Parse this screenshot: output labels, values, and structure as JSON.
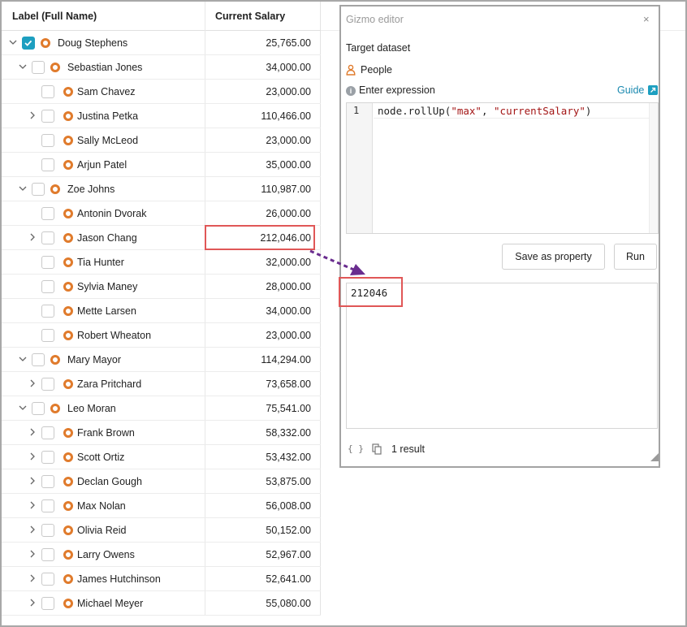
{
  "table": {
    "columns": [
      "Label (Full Name)",
      "Current Salary"
    ],
    "rows": [
      {
        "name": "Doug Stephens",
        "salary": "25,765.00",
        "level": 0,
        "caret": "expanded",
        "checked": true
      },
      {
        "name": "Sebastian Jones",
        "salary": "34,000.00",
        "level": 1,
        "caret": "expanded",
        "checked": false
      },
      {
        "name": "Sam Chavez",
        "salary": "23,000.00",
        "level": 2,
        "caret": "none",
        "checked": false
      },
      {
        "name": "Justina Petka",
        "salary": "110,466.00",
        "level": 2,
        "caret": "collapsed",
        "checked": false
      },
      {
        "name": "Sally McLeod",
        "salary": "23,000.00",
        "level": 2,
        "caret": "none",
        "checked": false
      },
      {
        "name": "Arjun Patel",
        "salary": "35,000.00",
        "level": 2,
        "caret": "none",
        "checked": false
      },
      {
        "name": "Zoe Johns",
        "salary": "110,987.00",
        "level": 1,
        "caret": "expanded",
        "checked": false
      },
      {
        "name": "Antonin Dvorak",
        "salary": "26,000.00",
        "level": 2,
        "caret": "none",
        "checked": false
      },
      {
        "name": "Jason Chang",
        "salary": "212,046.00",
        "level": 2,
        "caret": "collapsed",
        "checked": false
      },
      {
        "name": "Tia Hunter",
        "salary": "32,000.00",
        "level": 2,
        "caret": "none",
        "checked": false
      },
      {
        "name": "Sylvia Maney",
        "salary": "28,000.00",
        "level": 2,
        "caret": "none",
        "checked": false
      },
      {
        "name": "Mette Larsen",
        "salary": "34,000.00",
        "level": 2,
        "caret": "none",
        "checked": false
      },
      {
        "name": "Robert Wheaton",
        "salary": "23,000.00",
        "level": 2,
        "caret": "none",
        "checked": false
      },
      {
        "name": "Mary Mayor",
        "salary": "114,294.00",
        "level": 1,
        "caret": "expanded",
        "checked": false
      },
      {
        "name": "Zara Pritchard",
        "salary": "73,658.00",
        "level": 2,
        "caret": "collapsed",
        "checked": false
      },
      {
        "name": "Leo Moran",
        "salary": "75,541.00",
        "level": 1,
        "caret": "expanded",
        "checked": false
      },
      {
        "name": "Frank Brown",
        "salary": "58,332.00",
        "level": 2,
        "caret": "collapsed",
        "checked": false
      },
      {
        "name": "Scott Ortiz",
        "salary": "53,432.00",
        "level": 2,
        "caret": "collapsed",
        "checked": false
      },
      {
        "name": "Declan Gough",
        "salary": "53,875.00",
        "level": 2,
        "caret": "collapsed",
        "checked": false
      },
      {
        "name": "Max Nolan",
        "salary": "56,008.00",
        "level": 2,
        "caret": "collapsed",
        "checked": false
      },
      {
        "name": "Olivia Reid",
        "salary": "50,152.00",
        "level": 2,
        "caret": "collapsed",
        "checked": false
      },
      {
        "name": "Larry Owens",
        "salary": "52,967.00",
        "level": 2,
        "caret": "collapsed",
        "checked": false
      },
      {
        "name": "James Hutchinson",
        "salary": "52,641.00",
        "level": 2,
        "caret": "collapsed",
        "checked": false
      },
      {
        "name": "Michael Meyer",
        "salary": "55,080.00",
        "level": 2,
        "caret": "collapsed",
        "checked": false
      }
    ]
  },
  "gizmo": {
    "title": "Gizmo editor",
    "close_glyph": "×",
    "target_label": "Target dataset",
    "dataset": "People",
    "dataset_icon": "person-icon",
    "expression_label": "Enter expression",
    "guide_label": "Guide",
    "code": {
      "line_number": "1",
      "prefix": "node.rollUp(",
      "arg1": "\"max\"",
      "separator": ", ",
      "arg2": "\"currentSalary\"",
      "suffix": ")"
    },
    "save_label": "Save as property",
    "run_label": "Run",
    "result": "212046",
    "braces_glyph": "{ }",
    "result_count": "1 result"
  },
  "colors": {
    "accent": "#1d9fc0",
    "node_icon": "#e07b2c",
    "highlight": "#e05757",
    "arrow": "#6a2d8f"
  }
}
